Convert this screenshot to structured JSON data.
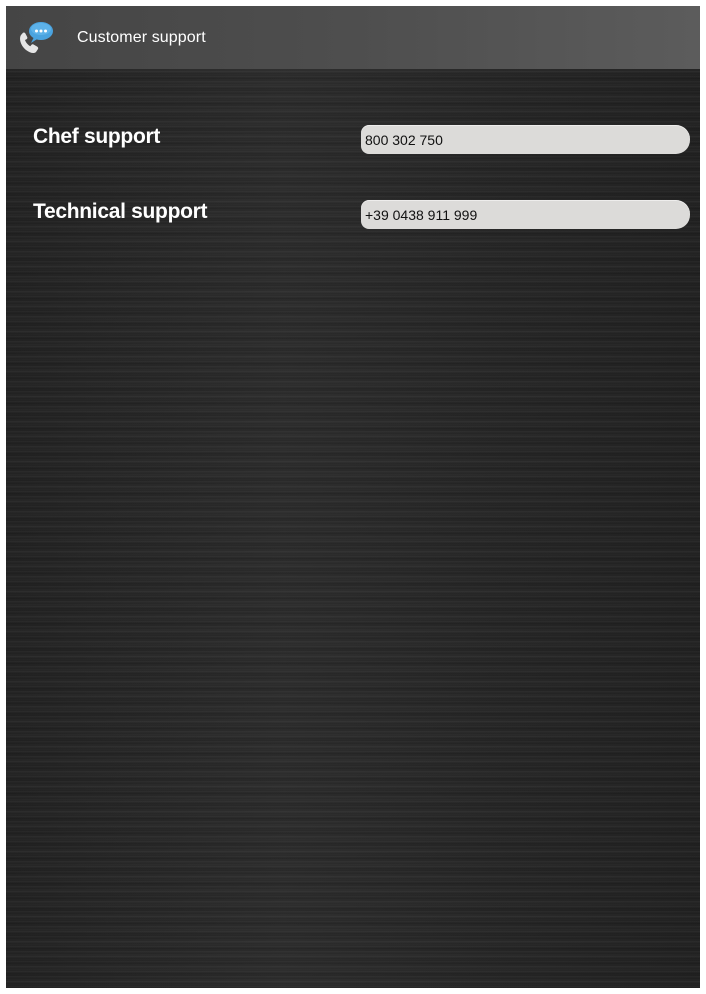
{
  "app": {
    "title": "Customer support",
    "icon": "support-chat-phone-icon"
  },
  "contacts": [
    {
      "label": "Chef support",
      "number": "800 302 750"
    },
    {
      "label": "Technical support",
      "number": "+39 0438 911 999"
    }
  ],
  "colors": {
    "title_bar": "#4e4e4e",
    "background": "#242424",
    "field": "#dcdbd9",
    "icon_bubble": "#4aa3df"
  }
}
